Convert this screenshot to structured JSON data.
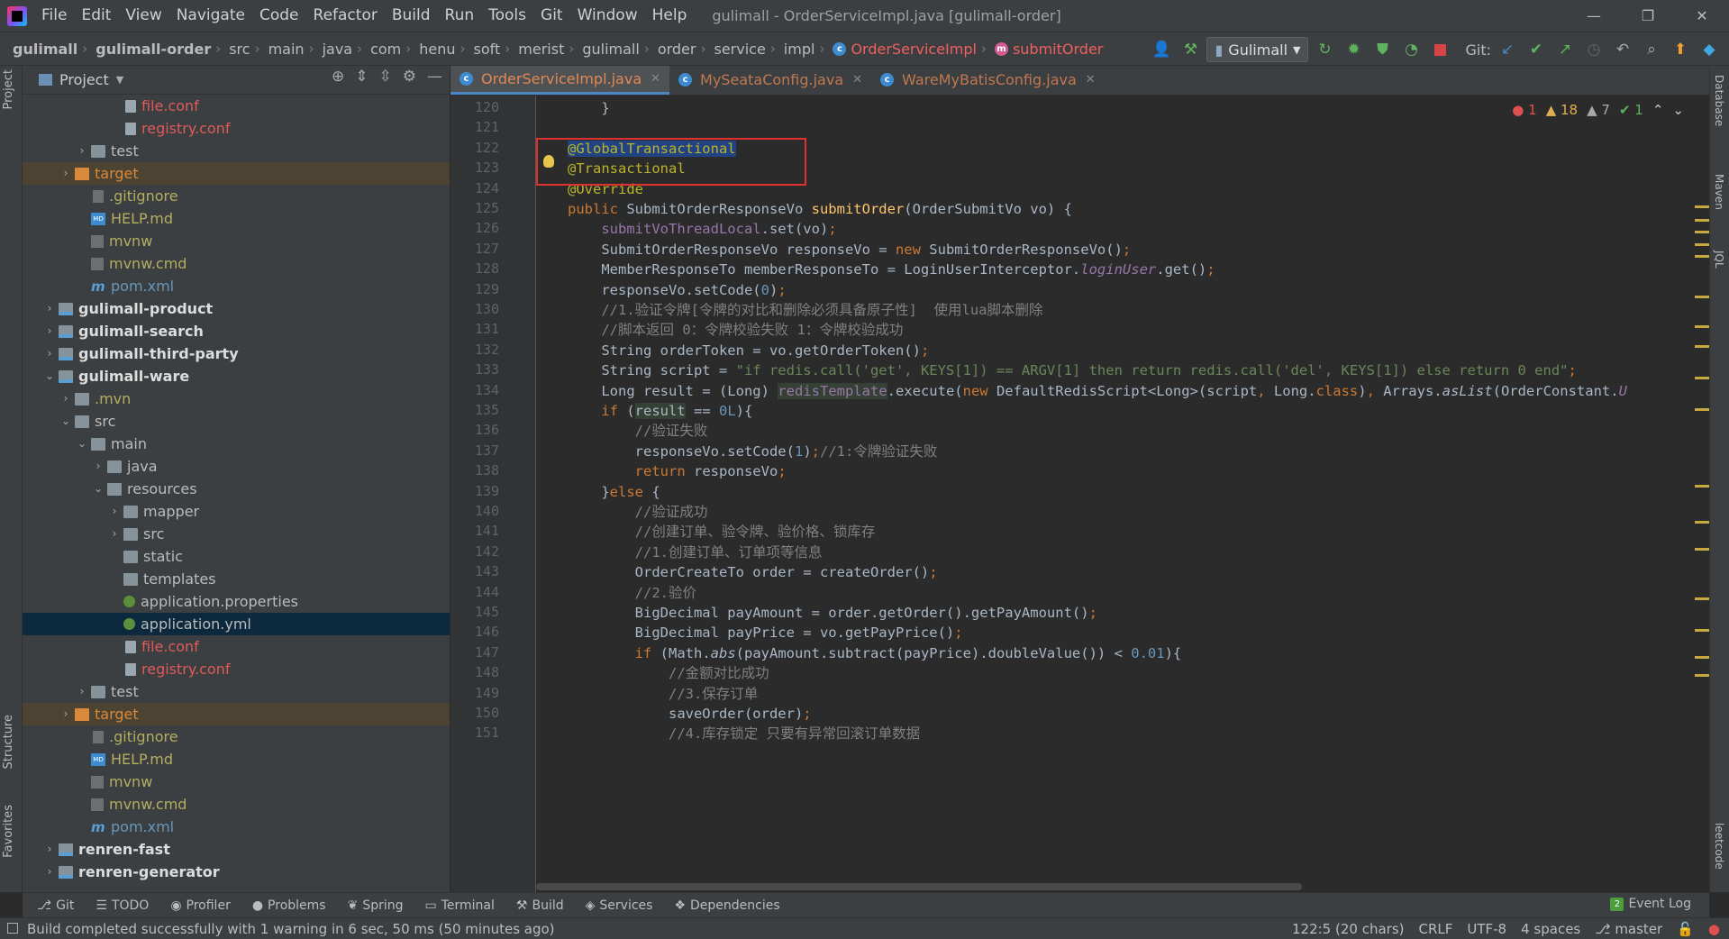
{
  "window": {
    "title": "gulimall - OrderServiceImpl.java [gulimall-order]",
    "minimize": "—",
    "restore": "❐",
    "close": "✕"
  },
  "menu": [
    "File",
    "Edit",
    "View",
    "Navigate",
    "Code",
    "Refactor",
    "Build",
    "Run",
    "Tools",
    "Git",
    "Window",
    "Help"
  ],
  "breadcrumbs": [
    "gulimall",
    "gulimall-order",
    "src",
    "main",
    "java",
    "com",
    "henu",
    "soft",
    "merist",
    "gulimall",
    "order",
    "service",
    "impl"
  ],
  "breadcrumb_class": "OrderServiceImpl",
  "breadcrumb_method": "submitOrder",
  "run_config": "Gulimall",
  "git_label": "Git:",
  "project": {
    "title": "Project",
    "tree": [
      {
        "label": "file.conf",
        "indent": 5,
        "icon": "file",
        "color": "red"
      },
      {
        "label": "registry.conf",
        "indent": 5,
        "icon": "file",
        "color": "red"
      },
      {
        "label": "test",
        "indent": 3,
        "icon": "folder",
        "arrow": "›"
      },
      {
        "label": "target",
        "indent": 2,
        "icon": "folder-orange",
        "arrow": "›",
        "color": "orange",
        "row": "hl-target"
      },
      {
        "label": ".gitignore",
        "indent": 3,
        "icon": "git",
        "color": "olive"
      },
      {
        "label": "HELP.md",
        "indent": 3,
        "icon": "md",
        "color": "olive"
      },
      {
        "label": "mvnw",
        "indent": 3,
        "icon": "cmd",
        "color": "olive"
      },
      {
        "label": "mvnw.cmd",
        "indent": 3,
        "icon": "cmd",
        "color": "olive"
      },
      {
        "label": "pom.xml",
        "indent": 3,
        "icon": "maven",
        "color": "blue"
      },
      {
        "label": "gulimall-product",
        "indent": 1,
        "icon": "module",
        "arrow": "›",
        "color": "bold"
      },
      {
        "label": "gulimall-search",
        "indent": 1,
        "icon": "module",
        "arrow": "›",
        "color": "bold"
      },
      {
        "label": "gulimall-third-party",
        "indent": 1,
        "icon": "module",
        "arrow": "›",
        "color": "bold"
      },
      {
        "label": "gulimall-ware",
        "indent": 1,
        "icon": "module",
        "arrow": "⌄",
        "color": "bold"
      },
      {
        "label": ".mvn",
        "indent": 2,
        "icon": "folder",
        "arrow": "›",
        "color": "olive"
      },
      {
        "label": "src",
        "indent": 2,
        "icon": "folder",
        "arrow": "⌄"
      },
      {
        "label": "main",
        "indent": 3,
        "icon": "folder",
        "arrow": "⌄"
      },
      {
        "label": "java",
        "indent": 4,
        "icon": "folder",
        "arrow": "›"
      },
      {
        "label": "resources",
        "indent": 4,
        "icon": "folder",
        "arrow": "⌄"
      },
      {
        "label": "mapper",
        "indent": 5,
        "icon": "folder",
        "arrow": "›"
      },
      {
        "label": "src",
        "indent": 5,
        "icon": "folder",
        "arrow": "›"
      },
      {
        "label": "static",
        "indent": 5,
        "icon": "folder"
      },
      {
        "label": "templates",
        "indent": 5,
        "icon": "folder"
      },
      {
        "label": "application.properties",
        "indent": 5,
        "icon": "props"
      },
      {
        "label": "application.yml",
        "indent": 5,
        "icon": "props",
        "row": "selected"
      },
      {
        "label": "file.conf",
        "indent": 5,
        "icon": "file",
        "color": "red"
      },
      {
        "label": "registry.conf",
        "indent": 5,
        "icon": "file",
        "color": "red"
      },
      {
        "label": "test",
        "indent": 3,
        "icon": "folder",
        "arrow": "›"
      },
      {
        "label": "target",
        "indent": 2,
        "icon": "folder-orange",
        "arrow": "›",
        "color": "orange",
        "row": "hl-target"
      },
      {
        "label": ".gitignore",
        "indent": 3,
        "icon": "git",
        "color": "olive"
      },
      {
        "label": "HELP.md",
        "indent": 3,
        "icon": "md",
        "color": "olive"
      },
      {
        "label": "mvnw",
        "indent": 3,
        "icon": "cmd",
        "color": "olive"
      },
      {
        "label": "mvnw.cmd",
        "indent": 3,
        "icon": "cmd",
        "color": "olive"
      },
      {
        "label": "pom.xml",
        "indent": 3,
        "icon": "maven",
        "color": "blue"
      },
      {
        "label": "renren-fast",
        "indent": 1,
        "icon": "module",
        "arrow": "›",
        "color": "bold"
      },
      {
        "label": "renren-generator",
        "indent": 1,
        "icon": "module",
        "arrow": "›",
        "color": "bold"
      }
    ]
  },
  "editor_tabs": [
    {
      "label": "OrderServiceImpl.java",
      "active": true
    },
    {
      "label": "MySeataConfig.java",
      "active": false
    },
    {
      "label": "WareMyBatisConfig.java",
      "active": false
    }
  ],
  "inspections": {
    "errors": "1",
    "warnings": "18",
    "weak_warnings": "7",
    "ok": "1"
  },
  "code_lines": [
    {
      "n": "120",
      "html": "<span>    }</span>"
    },
    {
      "n": "121",
      "html": ""
    },
    {
      "n": "122",
      "html": "<span class='ann sel-ann'>@GlobalTransactional</span>"
    },
    {
      "n": "123",
      "html": "<span class='ann'>@Transactional</span>"
    },
    {
      "n": "124",
      "html": "<span class='ann'>@Override</span>"
    },
    {
      "n": "125",
      "html": "<span class='kw'>public </span>SubmitOrderResponseVo <span class='mth'>submitOrder</span>(OrderSubmitVo vo) {"
    },
    {
      "n": "126",
      "html": "    <span class='fld'>submitVoThreadLocal</span>.set(vo)<span class='kw'>;</span>"
    },
    {
      "n": "127",
      "html": "    SubmitOrderResponseVo responseVo = <span class='kw'>new </span>SubmitOrderResponseVo()<span class='kw'>;</span>"
    },
    {
      "n": "128",
      "html": "    MemberResponseTo memberResponseTo = LoginUserInterceptor.<span class='fld ital'>loginUser</span>.get()<span class='kw'>;</span>"
    },
    {
      "n": "129",
      "html": "    responseVo.setCode(<span class='num'>0</span>)<span class='kw'>;</span>"
    },
    {
      "n": "130",
      "html": "    <span class='cmt'>//1.验证令牌[令牌的对比和删除必须具备原子性]  使用lua脚本删除</span>"
    },
    {
      "n": "131",
      "html": "    <span class='cmt'>//脚本返回 0：令牌校验失败 1：令牌校验成功</span>"
    },
    {
      "n": "132",
      "html": "    String orderToken = vo.getOrderToken()<span class='kw'>;</span>"
    },
    {
      "n": "133",
      "html": "    String script = <span class='str'>\"if redis.call('get', KEYS[1]) == ARGV[1] then return redis.call('del', KEYS[1]) else return 0 end\"</span><span class='kw'>;</span>"
    },
    {
      "n": "134",
      "html": "    Long result = (Long) <span class='fld hl-var'>redisTemplate</span>.execute(<span class='kw'>new </span>DefaultRedisScript&lt;Long&gt;(script<span class='kw'>, </span>Long.<span class='kw'>class</span>)<span class='kw'>, </span>Arrays.<span class='ital'>asList</span>(OrderConstant.<span class='fld ital'>U</span>"
    },
    {
      "n": "135",
      "html": "    <span class='kw'>if </span>(<span class='hl-var'>result</span> == <span class='num'>0L</span>){"
    },
    {
      "n": "136",
      "html": "        <span class='cmt'>//验证失败</span>"
    },
    {
      "n": "137",
      "html": "        responseVo.setCode(<span class='num'>1</span>)<span class='kw'>;</span><span class='cmt'>//1:令牌验证失败</span>"
    },
    {
      "n": "138",
      "html": "        <span class='kw'>return </span>responseVo<span class='kw'>;</span>"
    },
    {
      "n": "139",
      "html": "    }<span class='kw'>else </span>{"
    },
    {
      "n": "140",
      "html": "        <span class='cmt'>//验证成功</span>"
    },
    {
      "n": "141",
      "html": "        <span class='cmt'>//创建订单、验令牌、验价格、锁库存</span>"
    },
    {
      "n": "142",
      "html": "        <span class='cmt'>//1.创建订单、订单项等信息</span>"
    },
    {
      "n": "143",
      "html": "        OrderCreateTo order = createOrder()<span class='kw'>;</span>"
    },
    {
      "n": "144",
      "html": "        <span class='cmt'>//2.验价</span>"
    },
    {
      "n": "145",
      "html": "        BigDecimal payAmount = order.getOrder().getPayAmount()<span class='kw'>;</span>"
    },
    {
      "n": "146",
      "html": "        BigDecimal payPrice = vo.getPayPrice()<span class='kw'>;</span>"
    },
    {
      "n": "147",
      "html": "        <span class='kw'>if </span>(Math.<span class='ital'>abs</span>(payAmount.subtract(payPrice).doubleValue()) &lt; <span class='num'>0.01</span>){"
    },
    {
      "n": "148",
      "html": "            <span class='cmt'>//金额对比成功</span>"
    },
    {
      "n": "149",
      "html": "            <span class='cmt'>//3.保存订单</span>"
    },
    {
      "n": "150",
      "html": "            saveOrder(order)<span class='kw'>;</span>"
    },
    {
      "n": "151",
      "html": "            <span class='cmt'>//4.库存锁定 只要有异常回滚订单数据</span>"
    }
  ],
  "left_strip": [
    "Project",
    "Structure",
    "Favorites"
  ],
  "right_strip": [
    "Database",
    "Maven",
    "JQL",
    "leetcode"
  ],
  "bottom_tabs": [
    "Git",
    "TODO",
    "Profiler",
    "Problems",
    "Spring",
    "Terminal",
    "Build",
    "Services",
    "Dependencies"
  ],
  "event_log": {
    "count": "2",
    "label": "Event Log"
  },
  "status": {
    "message": "Build completed successfully with 1 warning in 6 sec, 50 ms (50 minutes ago)",
    "position": "122:5 (20 chars)",
    "line_sep": "CRLF",
    "encoding": "UTF-8",
    "indent": "4 spaces",
    "branch": "master"
  }
}
